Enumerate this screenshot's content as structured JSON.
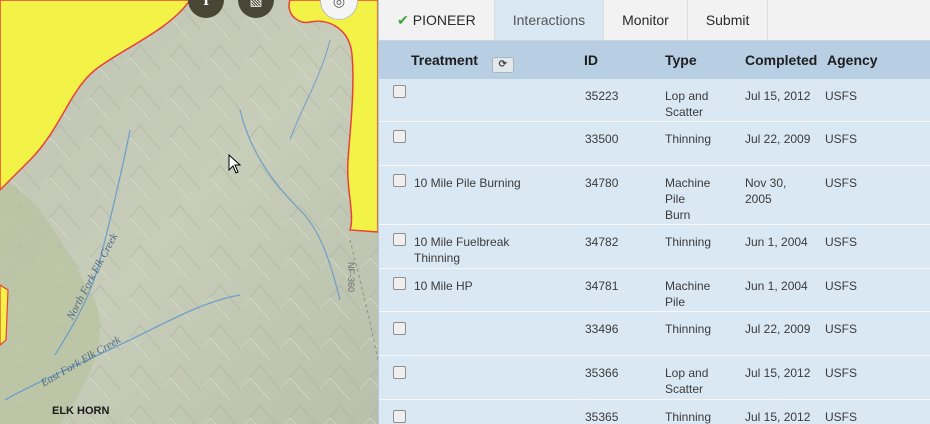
{
  "map": {
    "place_label": "ELK HORN",
    "river_labels": [
      "North Fork Elk Creek",
      "East Fork Elk Creek"
    ],
    "road_label": "NF-360",
    "buttons": [
      {
        "icon": "info-icon",
        "glyph": "ℹ"
      },
      {
        "icon": "layers-icon",
        "glyph": "▧"
      },
      {
        "icon": "locate-icon",
        "glyph": "◎"
      }
    ],
    "colors": {
      "boundary_fill": "#f2f247",
      "boundary_line": "#e8413a",
      "water": "#6fa0c8"
    }
  },
  "tabs": [
    {
      "label": "PIONEER",
      "icon": "check-icon",
      "active": false
    },
    {
      "label": "Interactions",
      "active": true
    },
    {
      "label": "Monitor",
      "active": false
    },
    {
      "label": "Submit",
      "active": false
    }
  ],
  "table": {
    "headers": {
      "treatment": "Treatment",
      "id": "ID",
      "type": "Type",
      "completed": "Completed",
      "agency": "Agency"
    },
    "rows": [
      {
        "treatment": "",
        "id": "35223",
        "type": "Lop and Scatter",
        "completed": "Jul 15, 2012",
        "agency": "USFS"
      },
      {
        "treatment": "",
        "id": "33500",
        "type": "Thinning",
        "completed": "Jul 22, 2009",
        "agency": "USFS"
      },
      {
        "treatment": "10 Mile Pile Burning",
        "id": "34780",
        "type": "Machine Pile Burn",
        "completed": "Nov 30, 2005",
        "agency": "USFS"
      },
      {
        "treatment": "10 Mile Fuelbreak Thinning",
        "id": "34782",
        "type": "Thinning",
        "completed": "Jun 1, 2004",
        "agency": "USFS"
      },
      {
        "treatment": "10 Mile HP",
        "id": "34781",
        "type": "Machine Pile",
        "completed": "Jun 1, 2004",
        "agency": "USFS"
      },
      {
        "treatment": "",
        "id": "33496",
        "type": "Thinning",
        "completed": "Jul 22, 2009",
        "agency": "USFS"
      },
      {
        "treatment": "",
        "id": "35366",
        "type": "Lop and Scatter",
        "completed": "Jul 15, 2012",
        "agency": "USFS"
      },
      {
        "treatment": "",
        "id": "35365",
        "type": "Thinning",
        "completed": "Jul 15, 2012",
        "agency": "USFS"
      }
    ]
  }
}
